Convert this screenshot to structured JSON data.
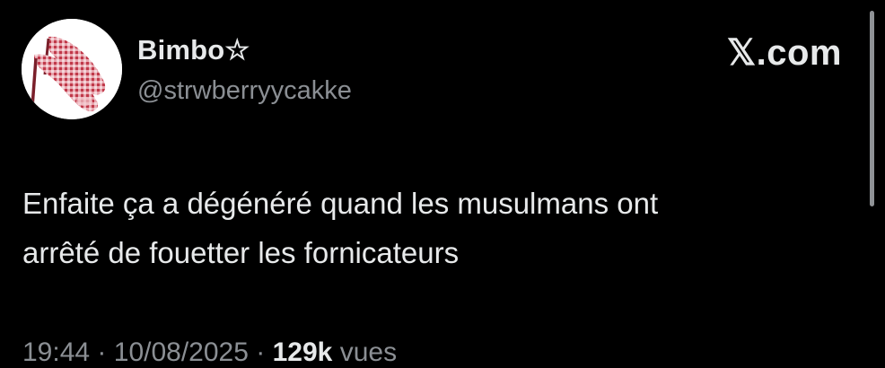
{
  "tweet": {
    "display_name": "Bimbo☆",
    "handle": "@strwberryycakke",
    "brand": "𝕏.com",
    "text_lines": [
      "Enfaite ça a dégénéré quand les musulmans ont",
      "arrêté de fouetter les fornicateurs"
    ],
    "time": "19:44",
    "date": "10/08/2025",
    "views_count": "129k",
    "views_label": "vues",
    "separator": "·"
  },
  "icons": {
    "avatar": "red-gingham-high-heel-shoes-photo"
  },
  "colors": {
    "background": "#000000",
    "text_primary": "#e7e9ea",
    "text_secondary": "#8b8f94",
    "shoe_red": "#c0394a"
  }
}
